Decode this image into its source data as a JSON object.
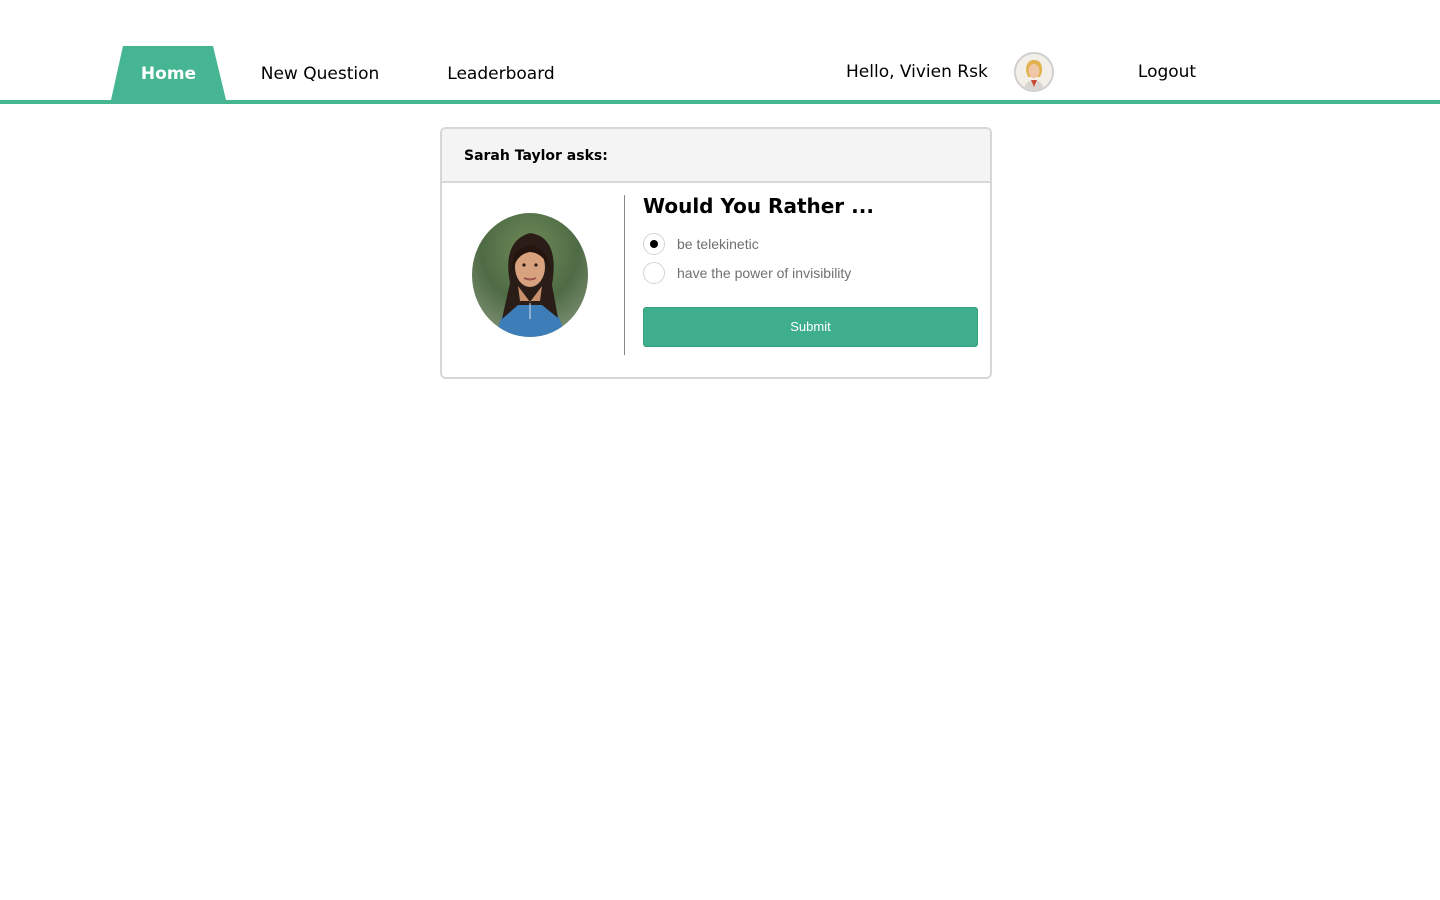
{
  "nav": {
    "tabs": [
      {
        "label": "Home",
        "active": true
      },
      {
        "label": "New Question",
        "active": false
      },
      {
        "label": "Leaderboard",
        "active": false
      }
    ],
    "greeting": "Hello, Vivien Rsk",
    "logout_label": "Logout",
    "accent_color": "#45b592"
  },
  "question_card": {
    "asker_text": "Sarah Taylor asks:",
    "title": "Would You Rather ...",
    "options": [
      {
        "label": "be telekinetic",
        "selected": true
      },
      {
        "label": "have the power of invisibility",
        "selected": false
      }
    ],
    "submit_label": "Submit",
    "button_color": "#3fae8c"
  }
}
